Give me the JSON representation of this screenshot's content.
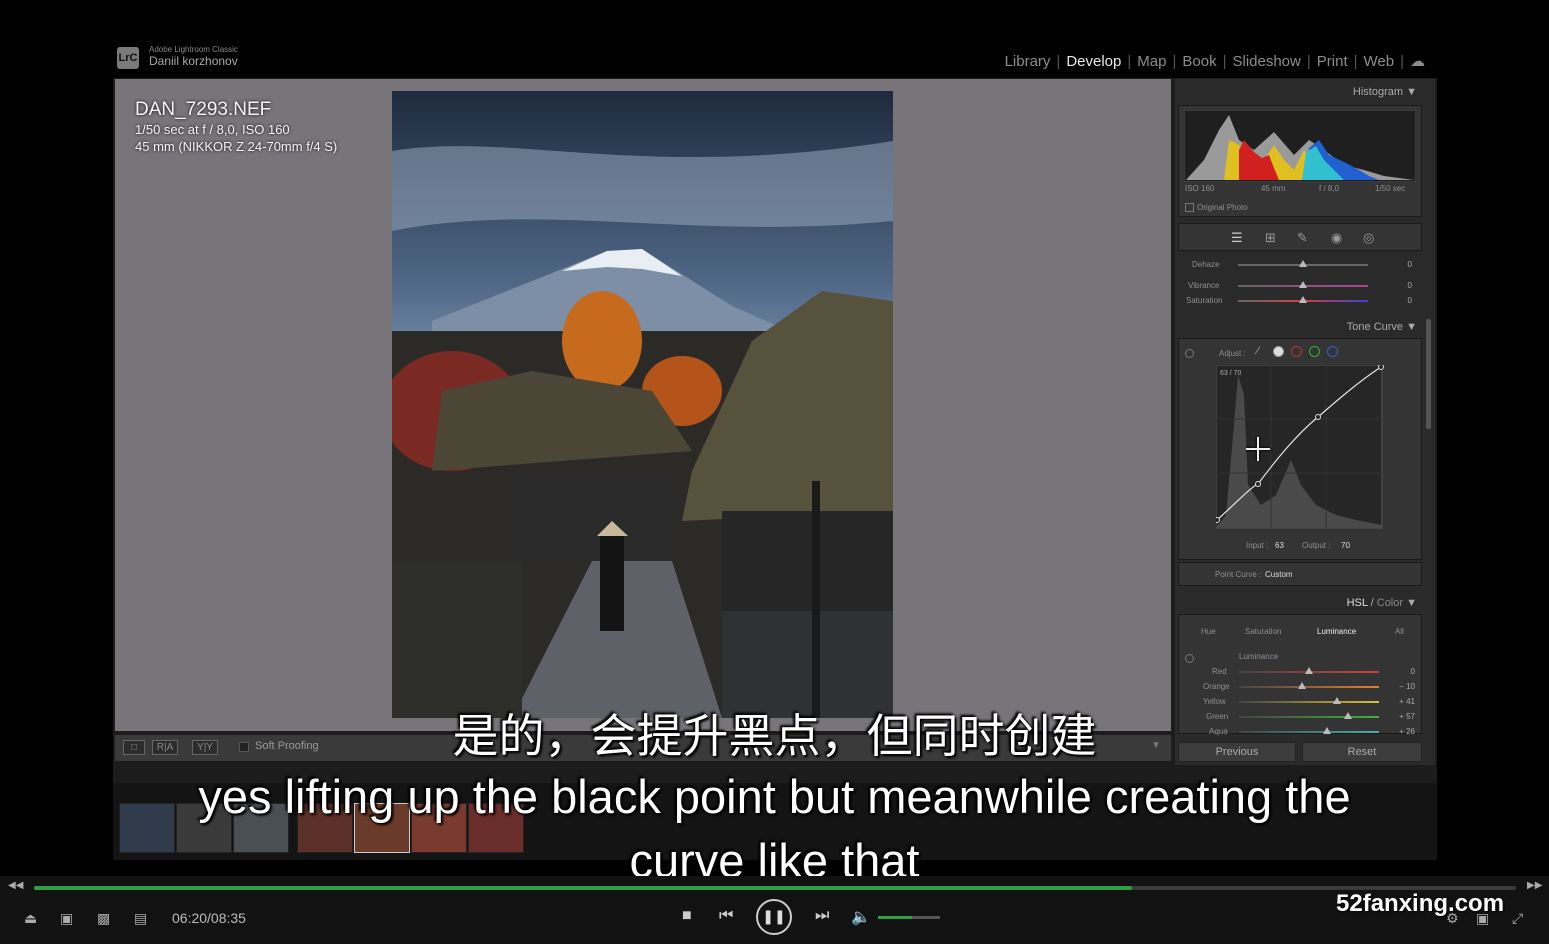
{
  "lightroom": {
    "app_name": "Adobe Lightroom Classic",
    "logo": "LrC",
    "user": "Daniil korzhonov",
    "modules": [
      "Library",
      "Develop",
      "Map",
      "Book",
      "Slideshow",
      "Print",
      "Web"
    ],
    "active_module": "Develop"
  },
  "photo_info": {
    "filename": "DAN_7293.NEF",
    "exposure": "1/50 sec at f / 8,0, ISO 160",
    "lens": "45 mm (NIKKOR Z 24-70mm f/4 S)"
  },
  "histogram": {
    "title": "Histogram",
    "iso": "ISO 160",
    "focal": "45 mm",
    "aperture": "f / 8,0",
    "shutter": "1/50 sec",
    "original_photo_label": "Original Photo"
  },
  "basic_sliders": [
    {
      "label": "Dehaze",
      "value": "0",
      "pos": 0.5
    },
    {
      "label": "Vibrance",
      "value": "0",
      "pos": 0.5
    },
    {
      "label": "Saturation",
      "value": "0",
      "pos": 0.5
    }
  ],
  "tone_curve": {
    "title": "Tone Curve",
    "adjust_label": "Adjust :",
    "readout": "63 / 70",
    "input_label": "Input :",
    "input_value": "63",
    "output_label": "Output :",
    "output_value": "70",
    "point_curve_label": "Point Curve :",
    "point_curve_value": "Custom"
  },
  "hsl": {
    "title_hsl": "HSL",
    "title_sep": " / ",
    "title_color": "Color",
    "tabs": [
      "Hue",
      "Saturation",
      "Luminance",
      "All"
    ],
    "active_tab": "Luminance",
    "section": "Luminance",
    "rows": [
      {
        "label": "Red",
        "value": "0",
        "pos": 0.5,
        "color": "#d04040"
      },
      {
        "label": "Orange",
        "value": "− 10",
        "pos": 0.45,
        "color": "#e08030"
      },
      {
        "label": "Yellow",
        "value": "+ 41",
        "pos": 0.7,
        "color": "#d8c030"
      },
      {
        "label": "Green",
        "value": "+ 57",
        "pos": 0.78,
        "color": "#40b040"
      },
      {
        "label": "Aqua",
        "value": "+ 26",
        "pos": 0.63,
        "color": "#40b0b0"
      }
    ]
  },
  "panel_buttons": {
    "previous": "Previous",
    "reset": "Reset"
  },
  "toolbar": {
    "soft_proofing": "Soft Proofing"
  },
  "subtitles": {
    "chinese": "是的，会提升黑点，但同时创建",
    "english_line1": "yes lifting up the black point but meanwhile creating the",
    "english_line2": "curve like that"
  },
  "player": {
    "time": "06:20/08:35",
    "progress": 0.741,
    "volume": 0.55
  },
  "watermark": "52fanxing.com"
}
